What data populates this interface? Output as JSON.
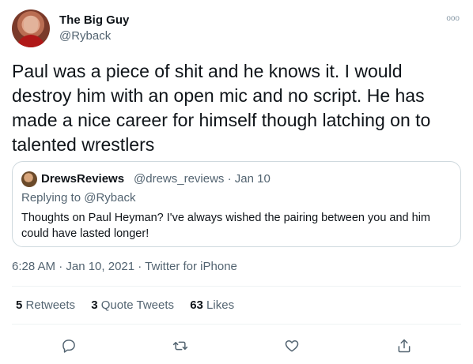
{
  "author": {
    "name": "The Big Guy",
    "handle": "@Ryback",
    "avatar_icon": "profile-avatar"
  },
  "more_icon": "more-options-icon",
  "more_glyph": "ooo",
  "tweet": {
    "text": "Paul was a piece of shit and he knows it. I would destroy him with an open mic and no script. He has made a nice career for himself though latching on to talented wrestlers"
  },
  "quoted_tweet": {
    "author_name": "DrewsReviews",
    "author_handle": "@drews_reviews · Jan 10",
    "replying_to": "Replying to @Ryback",
    "text": "Thoughts on Paul Heyman? I've always wished the pairing between you and him could have lasted longer!"
  },
  "meta": {
    "time": "6:28 AM · Jan 10, 2021",
    "separator": " · ",
    "source": "Twitter for iPhone"
  },
  "stats": {
    "retweets_count": "5",
    "retweets_label": "Retweets",
    "quote_count": "3",
    "quote_label": "Quote Tweets",
    "likes_count": "63",
    "likes_label": "Likes"
  },
  "actions": {
    "reply_icon": "reply-icon",
    "retweet_icon": "retweet-icon",
    "like_icon": "like-icon",
    "share_icon": "share-icon"
  },
  "colors": {
    "text": "#0f1419",
    "secondary": "#536471",
    "border": "#cfd9de"
  }
}
